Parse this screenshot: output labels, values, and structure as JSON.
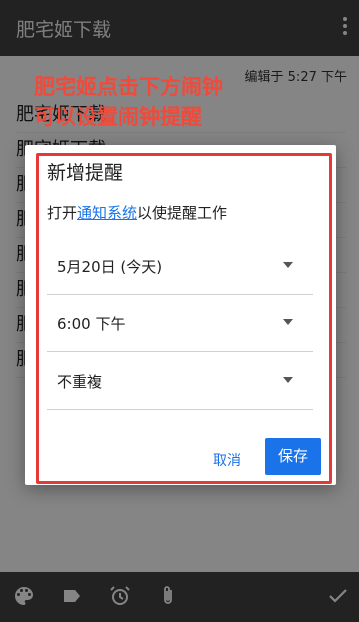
{
  "app": {
    "title": "肥宅姬下载"
  },
  "note": {
    "edited": "编辑于 5:27 下午",
    "lines": [
      "肥宅姬下载",
      "肥宅姬下载",
      "肥",
      "肥",
      "肥",
      "肥",
      "肥",
      "肥"
    ]
  },
  "annotation": {
    "line1": "肥宅姬点击下方闹钟",
    "line2": "可以设置闹钟提醒"
  },
  "dialog": {
    "title": "新增提醒",
    "desc_prefix": "打开",
    "desc_link": "通知系统",
    "desc_suffix": "以使提醒工作",
    "date": "5月20日 (今天)",
    "time": "6:00 下午",
    "repeat": "不重複",
    "cancel": "取消",
    "save": "保存"
  },
  "colors": {
    "accent": "#1a73e8",
    "annotation": "#e53935",
    "bar": "#424242"
  },
  "bottom_icons": [
    "palette-icon",
    "label-icon",
    "alarm-icon",
    "attachment-icon",
    "check-icon"
  ]
}
